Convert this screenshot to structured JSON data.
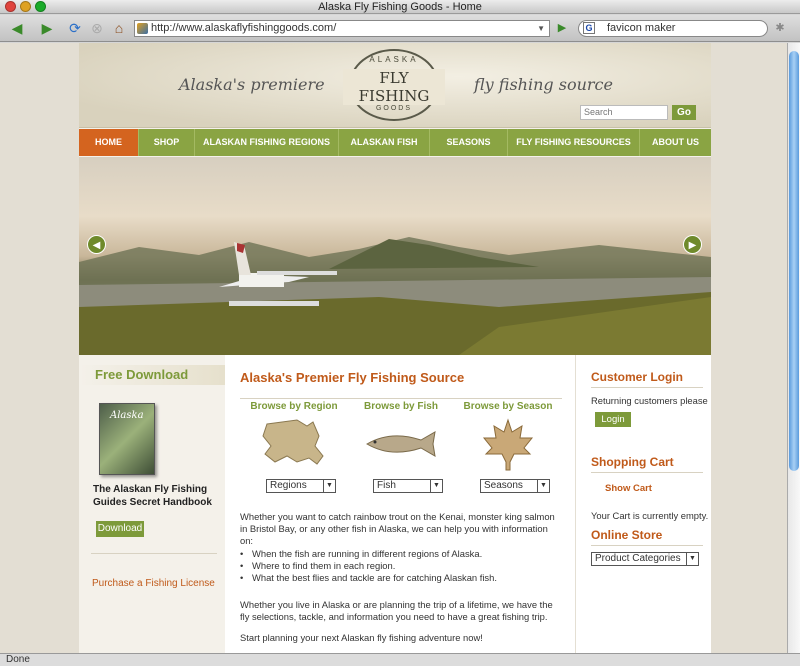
{
  "window": {
    "title": "Alaska Fly Fishing Goods - Home"
  },
  "browser": {
    "url": "http://www.alaskaflyfishinggoods.com/",
    "search_value": "favicon maker",
    "search_engine_icon": "G",
    "status": "Done"
  },
  "header": {
    "tagline_left": "Alaska's premiere",
    "tagline_right": "fly fishing source",
    "logo_top": "ALASKA",
    "logo_main": "FLY FISHING",
    "logo_bottom": "GOODS",
    "search_placeholder": "Search",
    "search_button": "Go"
  },
  "nav": [
    "HOME",
    "SHOP",
    "ALASKAN FISHING REGIONS",
    "ALASKAN FISH",
    "SEASONS",
    "FLY FISHING RESOURCES",
    "ABOUT US"
  ],
  "left": {
    "heading": "Free Download",
    "book_cover_title": "Alaska",
    "book_title": "The Alaskan Fly Fishing Guides Secret Handbook",
    "download_button": "Download",
    "license_link": "Purchase a Fishing License"
  },
  "center": {
    "title": "Alaska's Premier Fly Fishing Source",
    "browse": [
      {
        "label": "Browse by Region",
        "select": "Regions"
      },
      {
        "label": "Browse by Fish",
        "select": "Fish"
      },
      {
        "label": "Browse by Season",
        "select": "Seasons"
      }
    ],
    "intro": "Whether you want to catch rainbow trout on the Kenai, monster king salmon in Bristol Bay, or any other fish in Alaska, we can help you with information on:",
    "bullets": [
      "When the fish are running in different regions of Alaska.",
      "Where to find them in each region.",
      "What the best flies and tackle are for catching Alaskan fish."
    ],
    "para2": "Whether you live in Alaska or are planning the trip of a lifetime, we have the fly selections, tackle, and information you need to have a great fishing trip.",
    "para3": "Start planning your next Alaskan fly fishing adventure now!"
  },
  "right": {
    "login_heading": "Customer Login",
    "login_text": "Returning customers please",
    "login_button": "Login",
    "cart_heading": "Shopping Cart",
    "show_cart": "Show Cart",
    "cart_empty": "Your Cart is currently empty.",
    "store_heading": "Online Store",
    "store_select": "Product Categories"
  }
}
